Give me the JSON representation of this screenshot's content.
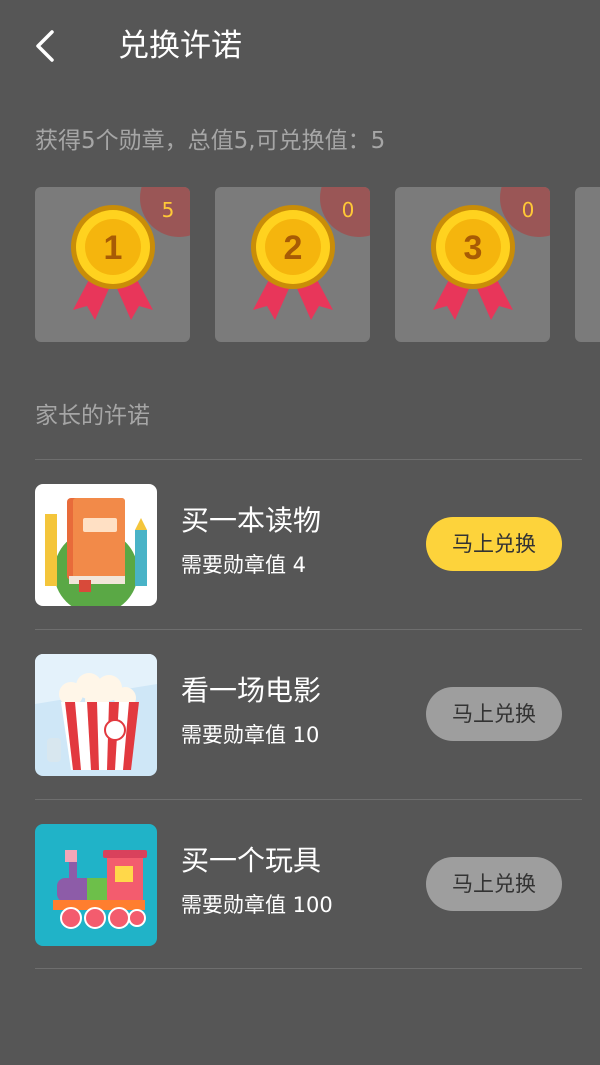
{
  "header": {
    "title": "兑换许诺",
    "back_icon": "chevron-left-icon"
  },
  "summary": {
    "text": "获得5个勋章，总值5,可兑换值：5"
  },
  "medals": [
    {
      "rank": "1",
      "count": "5"
    },
    {
      "rank": "2",
      "count": "0"
    },
    {
      "rank": "3",
      "count": "0"
    }
  ],
  "section": {
    "title": "家长的许诺"
  },
  "promises": [
    {
      "title": "买一本读物",
      "requirement": "需要勋章值 4",
      "button": "马上兑换",
      "enabled": true,
      "icon": "book-icon"
    },
    {
      "title": "看一场电影",
      "requirement": "需要勋章值 10",
      "button": "马上兑换",
      "enabled": false,
      "icon": "popcorn-icon"
    },
    {
      "title": "买一个玩具",
      "requirement": "需要勋章值 100",
      "button": "马上兑换",
      "enabled": false,
      "icon": "toy-train-icon"
    }
  ],
  "colors": {
    "background": "#565656",
    "accent": "#fdd33b",
    "disabled_button": "#9e9e9e",
    "muted_text": "#a6a6a6"
  }
}
